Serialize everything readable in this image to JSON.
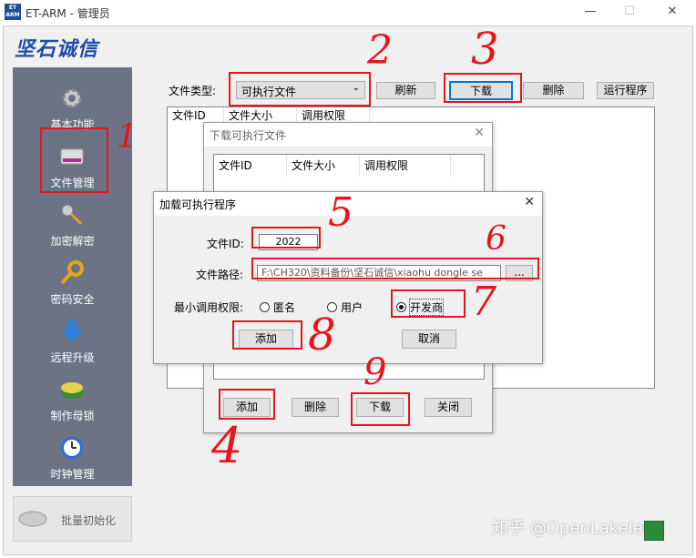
{
  "window": {
    "title": "ET-ARM - 管理员",
    "icon_text_top": "ET",
    "icon_text_bottom": "ARM",
    "controls": [
      "—",
      "☐",
      "✕"
    ]
  },
  "logo": "坚石诚信",
  "sidebar": {
    "items": [
      {
        "label": "基本功能",
        "icon": "gear-icon"
      },
      {
        "label": "文件管理",
        "icon": "disk-icon"
      },
      {
        "label": "加密解密",
        "icon": "keys-icon"
      },
      {
        "label": "密码安全",
        "icon": "key-icon"
      },
      {
        "label": "远程升级",
        "icon": "download-arrow-icon"
      },
      {
        "label": "制作母锁",
        "icon": "stack-icon"
      },
      {
        "label": "时钟管理",
        "icon": "clock-icon"
      }
    ],
    "batch_button": "批量初始化"
  },
  "toolbar": {
    "file_type_label": "文件类型:",
    "file_type_value": "可执行文件",
    "refresh": "刷新",
    "download": "下载",
    "delete": "删除",
    "run": "运行程序"
  },
  "main_list": {
    "columns": [
      "文件ID",
      "文件大小",
      "调用权限"
    ]
  },
  "download_dialog": {
    "title": "下载可执行文件",
    "columns": [
      "文件ID",
      "文件大小",
      "调用权限"
    ],
    "buttons": {
      "add": "添加",
      "delete": "删除",
      "download": "下载",
      "close": "关闭"
    }
  },
  "load_dialog": {
    "title": "加载可执行程序",
    "file_id_label": "文件ID:",
    "file_id_value": "2022",
    "path_label": "文件路径:",
    "path_value": "F:\\CH320\\资料备份\\坚石诚信\\xiaohu dongle se",
    "browse": "...",
    "min_perm_label": "最小调用权限:",
    "perm_options": [
      "匿名",
      "用户",
      "开发商"
    ],
    "perm_selected": "开发商",
    "add": "添加",
    "cancel": "取消"
  },
  "annotations": [
    "1",
    "2",
    "3",
    "4",
    "5",
    "6",
    "7",
    "8",
    "9"
  ],
  "watermark": "知乎 @OpenLakelet",
  "colors": {
    "sidebar_bg": "#6b7385",
    "annotation_red": "#e8141b",
    "logo_blue": "#1c4ea6"
  }
}
